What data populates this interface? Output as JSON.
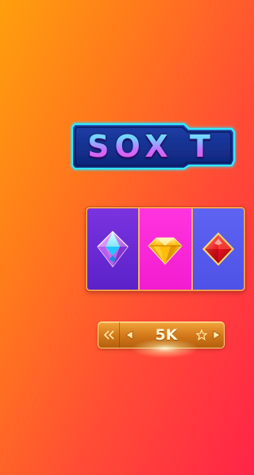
{
  "logo": {
    "title": "SOX T"
  },
  "reels": [
    {
      "symbol": "diamond-gem-icon",
      "bg": "#6b2bd6"
    },
    {
      "symbol": "yellow-diamond-icon",
      "bg": "#ff2bd8"
    },
    {
      "symbol": "red-diamond-suit-icon",
      "bg": "#5a5cf0"
    }
  ],
  "bet": {
    "value": "5K"
  },
  "colors": {
    "background_start": "#ff9f0d",
    "background_end": "#ff2448",
    "frame": "#ff9b4a",
    "bet_bar": "#d1771a"
  }
}
